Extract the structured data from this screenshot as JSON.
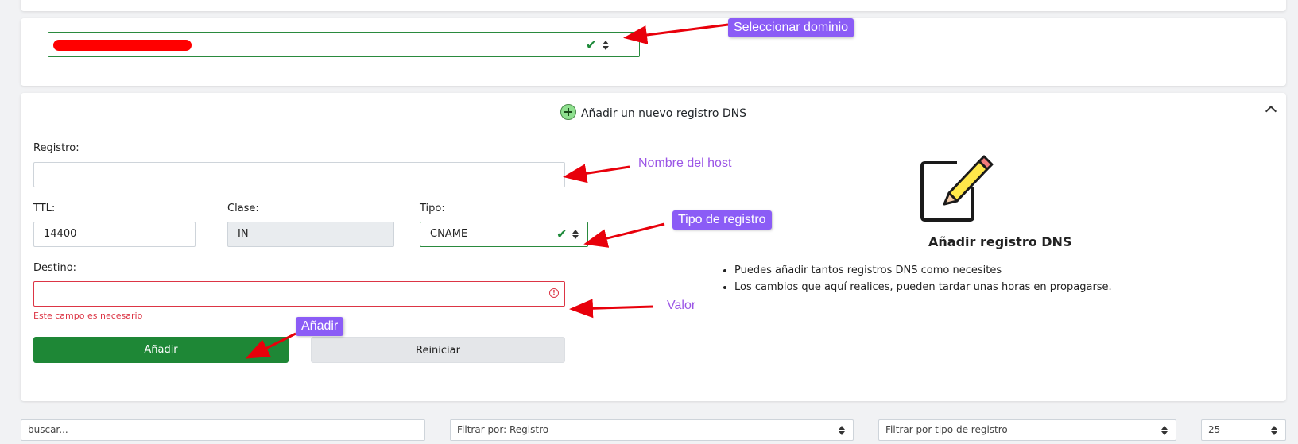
{
  "domain": {
    "select_value_redacted": true
  },
  "add_section": {
    "title": "Añadir un nuevo registro DNS",
    "registro_label": "Registro:",
    "registro_value": "",
    "ttl_label": "TTL:",
    "ttl_value": "14400",
    "clase_label": "Clase:",
    "clase_value": "IN",
    "tipo_label": "Tipo:",
    "tipo_value": "CNAME",
    "destino_label": "Destino:",
    "destino_value": "",
    "destino_error": "Este campo es necesario",
    "add_button": "Añadir",
    "reset_button": "Reiniciar"
  },
  "help": {
    "icon": "edit-pencil-icon",
    "title": "Añadir registro DNS",
    "bullets": [
      "Puedes añadir tantos registros DNS como necesites",
      "Los cambios que aquí realices, pueden tardar unas horas en propagarse."
    ]
  },
  "filters": {
    "search_placeholder": "buscar...",
    "filter_by": "Filtrar por: Registro",
    "filter_type": "Filtrar por tipo de registro",
    "page_size": "25"
  },
  "annotations": {
    "select_domain": "Seleccionar dominio",
    "host_name": "Nombre del host",
    "record_type": "Tipo de registro",
    "value": "Valor",
    "add": "Añadir"
  },
  "colors": {
    "annotation_purple": "#8b5cf6",
    "arrow_red": "#e8000b",
    "primary_green": "#1e8736",
    "error_red": "#dc3545"
  }
}
